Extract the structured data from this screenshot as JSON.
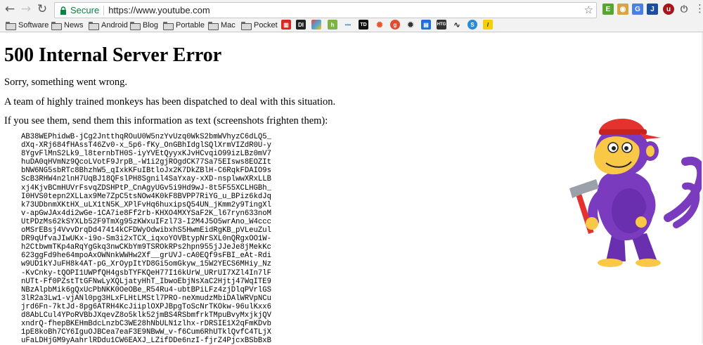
{
  "browser": {
    "secure_label": "Secure",
    "url": "https://www.youtube.com",
    "bookmarks": [
      "Software",
      "News",
      "Android",
      "Blog",
      "Portable",
      "Mac",
      "Pocket"
    ]
  },
  "page": {
    "title": "500 Internal Server Error",
    "line1": "Sorry, something went wrong.",
    "line2": "A team of highly trained monkeys has been dispatched to deal with this situation.",
    "line3": "If you see them, send them this information as text (screenshots frighten them):",
    "debug_lines": [
      "AB38WEPhidwB-jCg2JntthqROuU0W5nzYvUzq0WkS2bmWVhyzC6dLQ5_",
      "dXq-XRj684fHAssT46Zv0-x_5p6-fKy_OnGBhIdglSQlXrmVIZdR0U-y",
      "8YgvFlMnS2Lk9_l8ternbTH0S-iyYVEtQyyxKJvHCvqiO99izLBz0mV7",
      "huDA0qHVmNz9QcoLVotF9JrpB_-W1i2gjROgdCK77Sa75EIsws8EOZIt",
      "bNW6NG5sbRTc8BhzhW5_qIxkKFuIBtloJx2K7DkZBlH-C6RqkFDAIO9s",
      "ScB3RHW4n2lnH7UqBJ18QFslPH8Sgnil4SaYxay-xXD-nsplwwXRxLLB",
      "xj4KjvBCmHUVrFsvqZDSHPtP_CnAgyUGv5i9Hd9wJ-8t5F55XCLHGBh_",
      "I0HVS0tepn2XLLax9Me7ZpC5tsNOw4K0kF8BVPP7RiYG_u_BPiz6kdJq",
      "k73UDbnmXKtHX_uLX1tN5K_XPlFvHq6huxipsQ54UN_jKmm2y9TingXl",
      "v-apGwJAx4di2wGe-1CA7ie8Ff2rb-KHXO4MXYSaF2K_l67ryn633noM",
      "UtPDzMs62kSYXLb52F9TmXg95zKWxuIFzl73-I2M4J5O5wrAno_W4ccc",
      "oMSrEBsj4VvvDrqDd47414kCFDWyOdwibxhS5HwmEidRgKB_pVLeuZul",
      "DR9qUfvaJIwUKx-i9o-Sm3i2xTCX_iqxoYOVBtypNrSXL0nQRgxOO1W-",
      "h2CtbwmTKp4aRqYgGkq3nwCKbYm9TSROkRPs2hpn955jJJeJe8jMekKc",
      "623ggFd9he64mpoAxOWNnkWWHw2Xf__grUVJ-cA0EQf9sFBI_eAt-Rdi",
      "w9UD1kYJuFH8k4AT-pG_XrOypItYD8Gi5omGkyw_15W2YECS6MHiy_Nz",
      "-KvCnky-tQOPI1UWPfQH4gsbTYFKQeH77I16kUrW_URrUI7XZl4In7lF",
      "nUTt-Ff0PZstTtGFNwLyXQLjatyHhT_IbwoEbjNsXaC2Hjtj47WqITE9",
      "NBzAlpbMik6gQxUcPbNKK0OeOBe_R54Ru4-ubtBPiLFz4zjDlqPVrlGS",
      "3lR2a3Lw1-vjANl0pg3HLxFLHtLMStl7PRO-neXmudzMbiDAlWRVpNCu",
      "jrd6Fn-7ktJd-8pg6ATRH4KcJiiplOXPJBpgToScNrTKOkw-96ulKxx6",
      "d8AbLCul4YPoRVBbJXqevZ8o5klk52jmBS4RSbmfrkTMpuBvyMxjkjQV",
      "xndrQ-fhepBKEHmBdcLnzbC3WE28hNbULN1zlhx-rDRSIE1X2qFmKDvb",
      "1pE8koBh7CY6IguOJBCea7eaF3E9NBwW_v-f6Cum6RhUTklQvfC4TLjX",
      "uFaLDHjGM9yAahrlRDdu1CW6EAXJ_LZifDDe6nzI-fjrZ4PjcxBSbBxB"
    ]
  },
  "colors": {
    "secure_green": "#0b8043",
    "monkey_purple": "#7b3bbf",
    "monkey_face": "#f9c846",
    "hat_red": "#e4332f",
    "hammer_gray": "#9aa1a8"
  }
}
